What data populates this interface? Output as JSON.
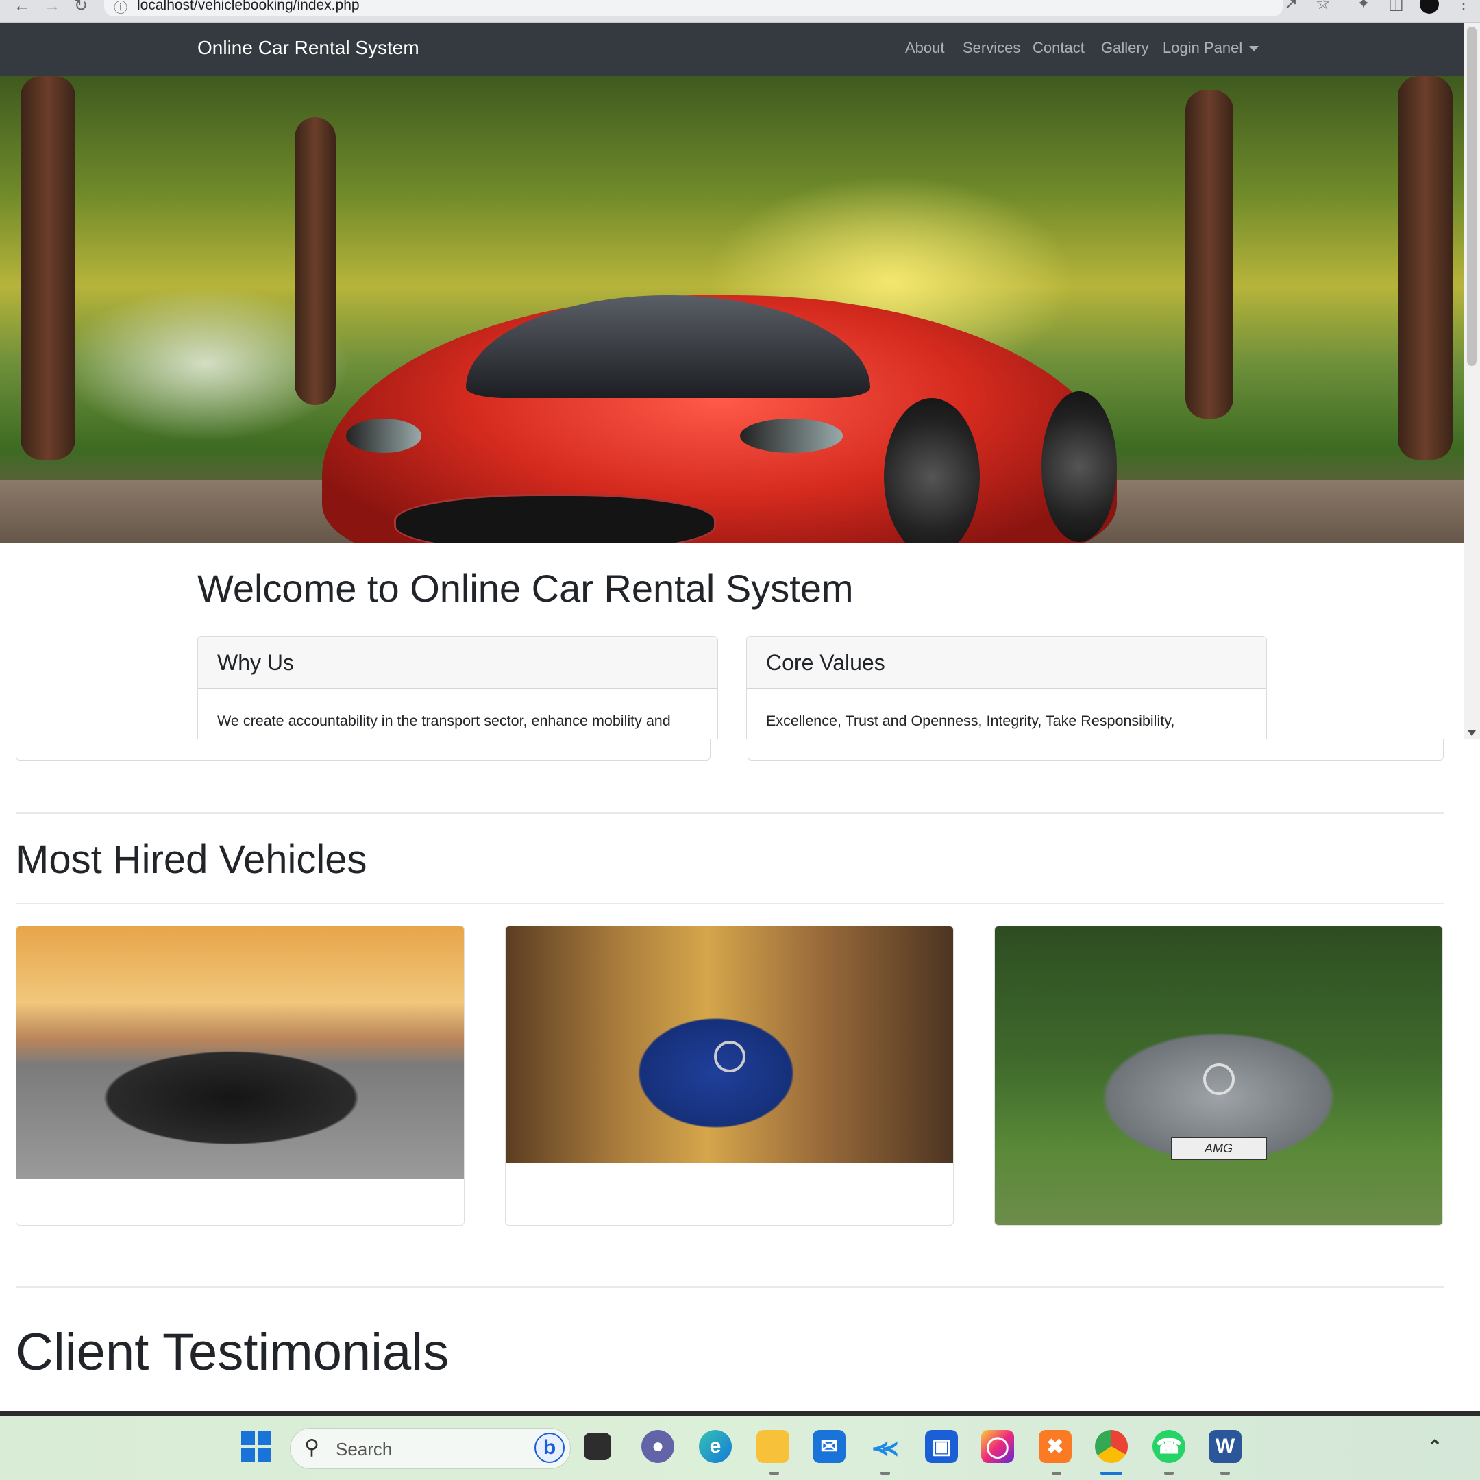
{
  "browser": {
    "url": "localhost/vehiclebooking/index.php"
  },
  "navbar": {
    "brand": "Online Car Rental System",
    "links": [
      "About",
      "Services",
      "Contact",
      "Gallery",
      "Login Panel"
    ]
  },
  "main": {
    "welcome_heading": "Welcome to Online Car Rental System",
    "cards": [
      {
        "header": "Why Us",
        "body": "We create accountability in the transport sector, enhance mobility and"
      },
      {
        "header": "Core Values",
        "body": "Excellence, Trust and Openness, Integrity, Take Responsibility,"
      }
    ]
  },
  "sections": {
    "most_hired": "Most Hired Vehicles",
    "testimonials": "Client Testimonials"
  },
  "vehicles": [
    {
      "image": "black-muscle-car"
    },
    {
      "image": "blue-mercedes-amg-gt"
    },
    {
      "image": "silver-mercedes-amg-gt",
      "plate_text": "AMG"
    }
  ],
  "taskbar": {
    "search_placeholder": "Search",
    "apps": [
      "start-icon",
      "bing-icon",
      "task-view-icon",
      "teams-icon",
      "edge-icon",
      "file-explorer-icon",
      "mail-icon",
      "vscode-icon",
      "store-icon",
      "instagram-icon",
      "xampp-icon",
      "chrome-icon",
      "whatsapp-icon",
      "word-icon"
    ]
  },
  "colors": {
    "navbar_bg": "#343a40",
    "nav_link": "rgba(255,255,255,0.6)",
    "card_header_bg": "#f7f7f7"
  }
}
